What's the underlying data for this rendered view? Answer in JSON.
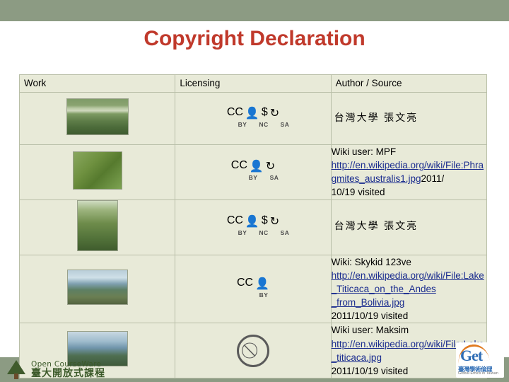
{
  "slide": {
    "title": "Copyright Declaration",
    "band_color": "#8c9b83",
    "title_color": "#c0392b",
    "table_bg": "#e8ead8",
    "link_color": "#1b2d8f"
  },
  "table": {
    "headers": [
      "Work",
      "Licensing",
      "Author / Source"
    ],
    "rows": [
      {
        "work_thumb": "wetland-grass-photo",
        "license": {
          "icons": [
            "cc",
            "by",
            "nc",
            "sa"
          ],
          "labels": [
            "BY",
            "NC",
            "SA"
          ]
        },
        "source_lines": [
          "台灣大學  張文亮"
        ],
        "source_style": "cjk"
      },
      {
        "work_thumb": "reed-leaves-photo",
        "license": {
          "icons": [
            "cc",
            "by",
            "sa"
          ],
          "labels": [
            "BY",
            "SA"
          ]
        },
        "source_lines": [
          "Wiki user: MPF",
          "http://en.wikipedia.org/wiki/File:Phragmites_australis1.jpg",
          "2011/10/19 visited"
        ],
        "link_line": 1,
        "link_text": "http://en.wikipedia.org/wiki/File:Phragmites_australis1.jpg",
        "link_trailing": "2011/",
        "line3": "10/19 visited"
      },
      {
        "work_thumb": "reed-field-vertical-photo",
        "license": {
          "icons": [
            "cc",
            "by",
            "nc",
            "sa"
          ],
          "labels": [
            "BY",
            "NC",
            "SA"
          ]
        },
        "source_lines": [
          "台灣大學  張文亮"
        ],
        "source_style": "cjk"
      },
      {
        "work_thumb": "lake-titicaca-shore-photo",
        "license": {
          "icons": [
            "cc",
            "by"
          ],
          "labels": [
            "BY"
          ]
        },
        "source_lines": [
          "Wiki: Skykid 123ve",
          "http://en.wikipedia.org/wiki/File:Lake_Titicaca_on_the_Andes",
          "_from_Bolivia.jpg",
          "2011/10/19 visited"
        ]
      },
      {
        "work_thumb": "lake-titicaca-water-photo",
        "license": {
          "icons": [
            "zero"
          ],
          "labels": []
        },
        "source_lines": [
          "Wiki user: Maksim",
          "http://en.wikipedia.org/wiki/File:Lake_titicaca.jpg",
          "2011/10/19 visited"
        ]
      }
    ]
  },
  "footer": {
    "ocw_line1": "Open CourseWare",
    "ocw_line2": "臺大開放式課程",
    "get_title": "Get",
    "get_sub": "臺灣學術倫理",
    "get_sub2": "Global Ethics in Taiwan"
  }
}
